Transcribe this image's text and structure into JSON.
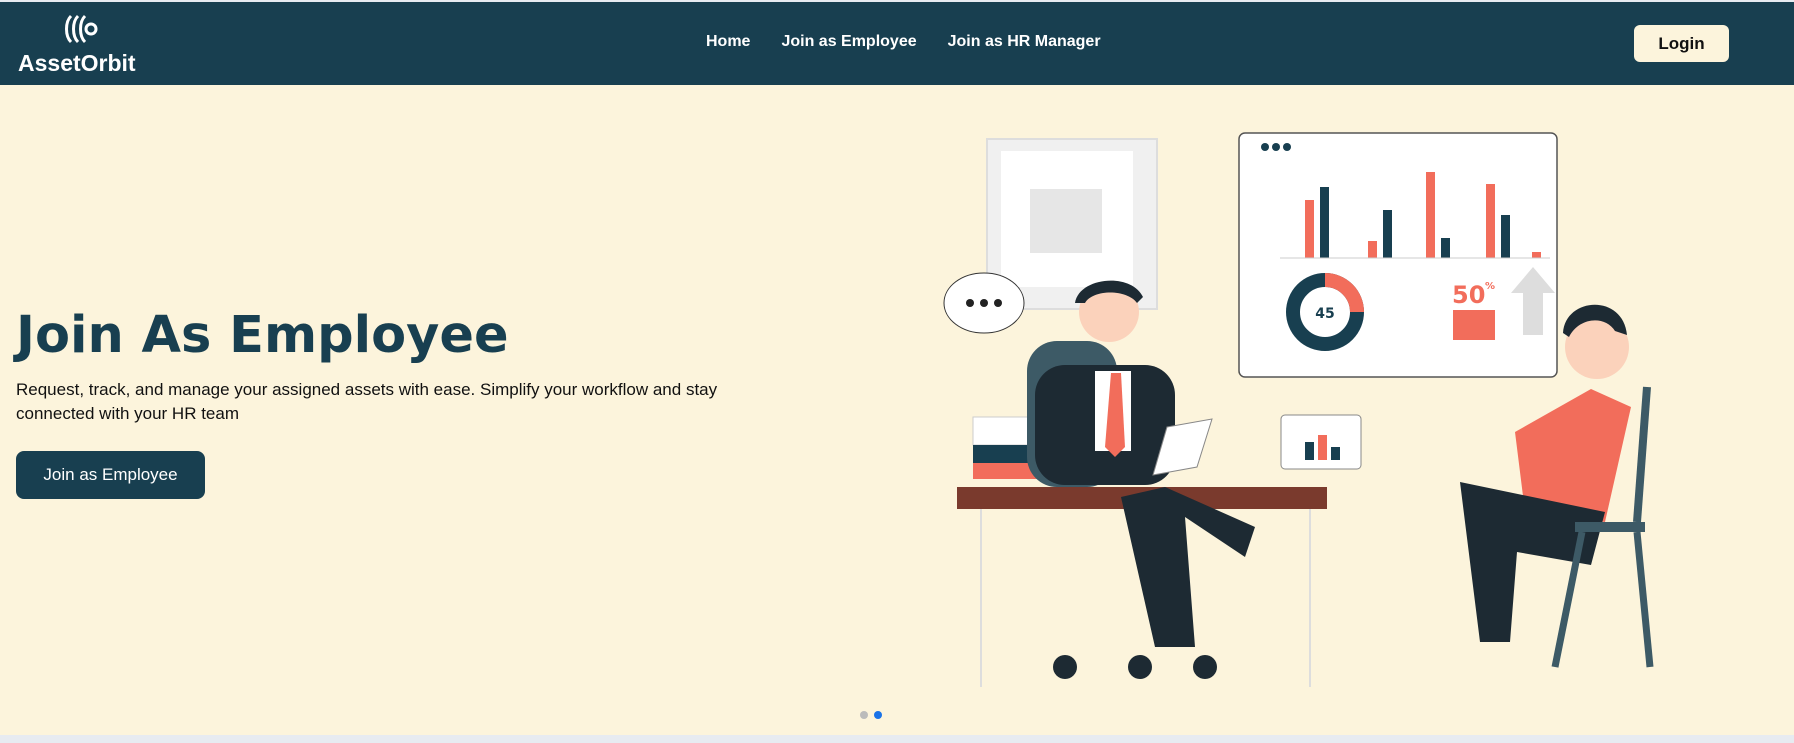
{
  "header": {
    "brand": "AssetOrbit",
    "nav": [
      {
        "label": "Home"
      },
      {
        "label": "Join as Employee"
      },
      {
        "label": "Join as HR Manager"
      }
    ],
    "login_label": "Login"
  },
  "hero": {
    "title": "Join As Employee",
    "description": "Request, track, and manage your assigned assets with ease. Simplify your workflow and stay connected with your HR team",
    "cta_label": "Join as Employee",
    "illustration": {
      "donut_value": "45",
      "percent_value": "50",
      "percent_sign": "%"
    }
  },
  "carousel": {
    "slide_count": 2,
    "active_index": 1
  },
  "colors": {
    "navy": "#183f50",
    "cream": "#fcf4dc",
    "coral": "#f26d5b",
    "accent_blue": "#1a73e8"
  },
  "icons": [
    "logo-mark-icon",
    "speech-bubble-icon",
    "arrow-up-icon"
  ]
}
